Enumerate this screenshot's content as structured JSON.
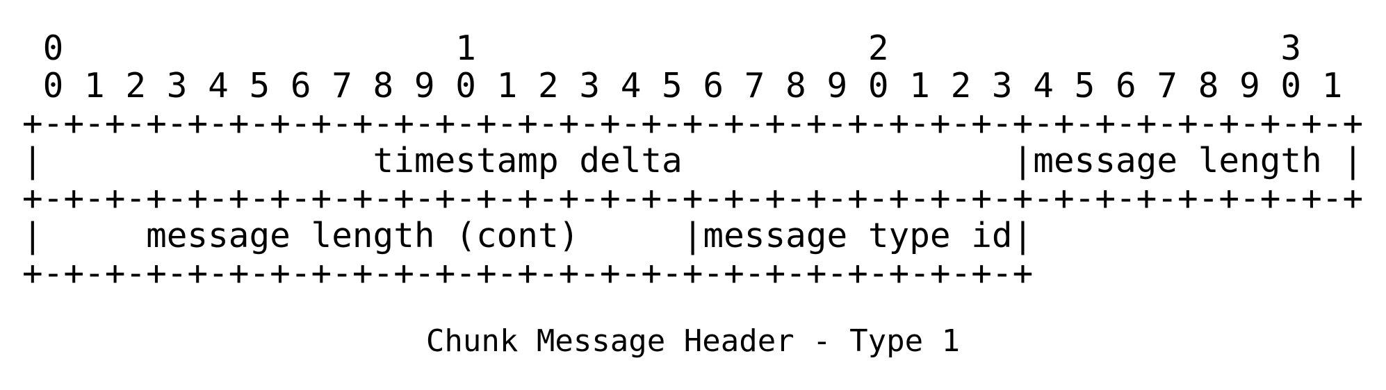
{
  "diagram": {
    "bit_tens_row": " 0                   1                   2                   3",
    "bit_units_row": " 0 1 2 3 4 5 6 7 8 9 0 1 2 3 4 5 6 7 8 9 0 1 2 3 4 5 6 7 8 9 0 1",
    "border_full": "+-+-+-+-+-+-+-+-+-+-+-+-+-+-+-+-+-+-+-+-+-+-+-+-+-+-+-+-+-+-+-+-+",
    "row1": "|                timestamp delta                |message length |",
    "row2": "|     message length (cont)     |message type id|",
    "border_partial": "+-+-+-+-+-+-+-+-+-+-+-+-+-+-+-+-+-+-+-+-+-+-+-+-+"
  },
  "caption": "Chunk Message Header - Type 1"
}
